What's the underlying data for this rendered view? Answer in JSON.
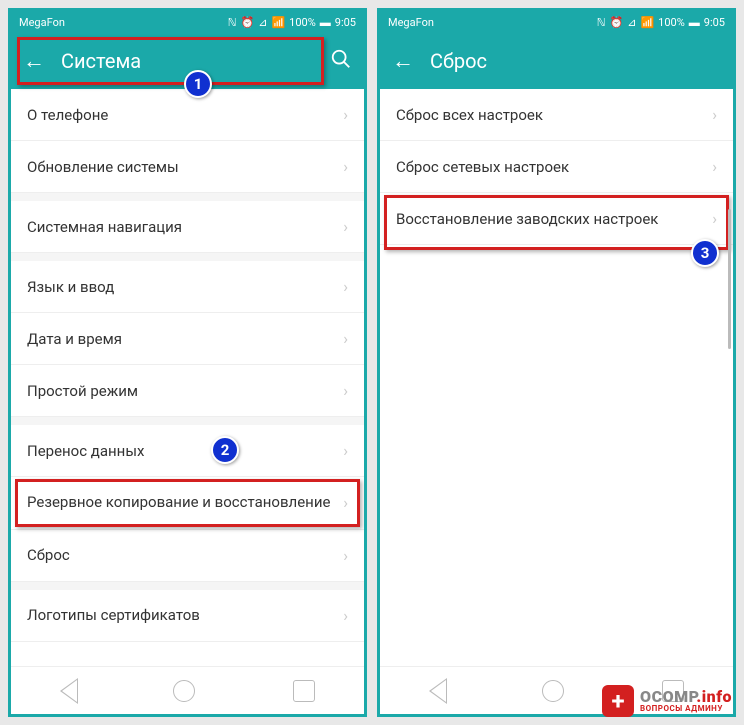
{
  "status": {
    "carrier": "MegaFon",
    "battery": "100%",
    "time": "9:05"
  },
  "left": {
    "title": "Система",
    "items": [
      {
        "label": "О телефоне"
      },
      {
        "label": "Обновление системы"
      },
      {
        "label": "Системная навигация",
        "gap_before": true
      },
      {
        "label": "Язык и ввод",
        "gap_before": true
      },
      {
        "label": "Дата и время"
      },
      {
        "label": "Простой режим"
      },
      {
        "label": "Перенос данных",
        "gap_before": true
      },
      {
        "label": "Резервное копирование и восстановление"
      },
      {
        "label": "Сброс"
      },
      {
        "label": "Логотипы сертификатов",
        "gap_before": true
      }
    ]
  },
  "right": {
    "title": "Сброс",
    "items": [
      {
        "label": "Сброс всех настроек"
      },
      {
        "label": "Сброс сетевых настроек"
      },
      {
        "label": "Восстановление заводских настроек"
      }
    ]
  },
  "badges": {
    "b1": "1",
    "b2": "2",
    "b3": "3"
  },
  "watermark": {
    "main1": "OCOMP",
    "main2": ".info",
    "sub": "ВОПРОСЫ АДМИНУ"
  }
}
